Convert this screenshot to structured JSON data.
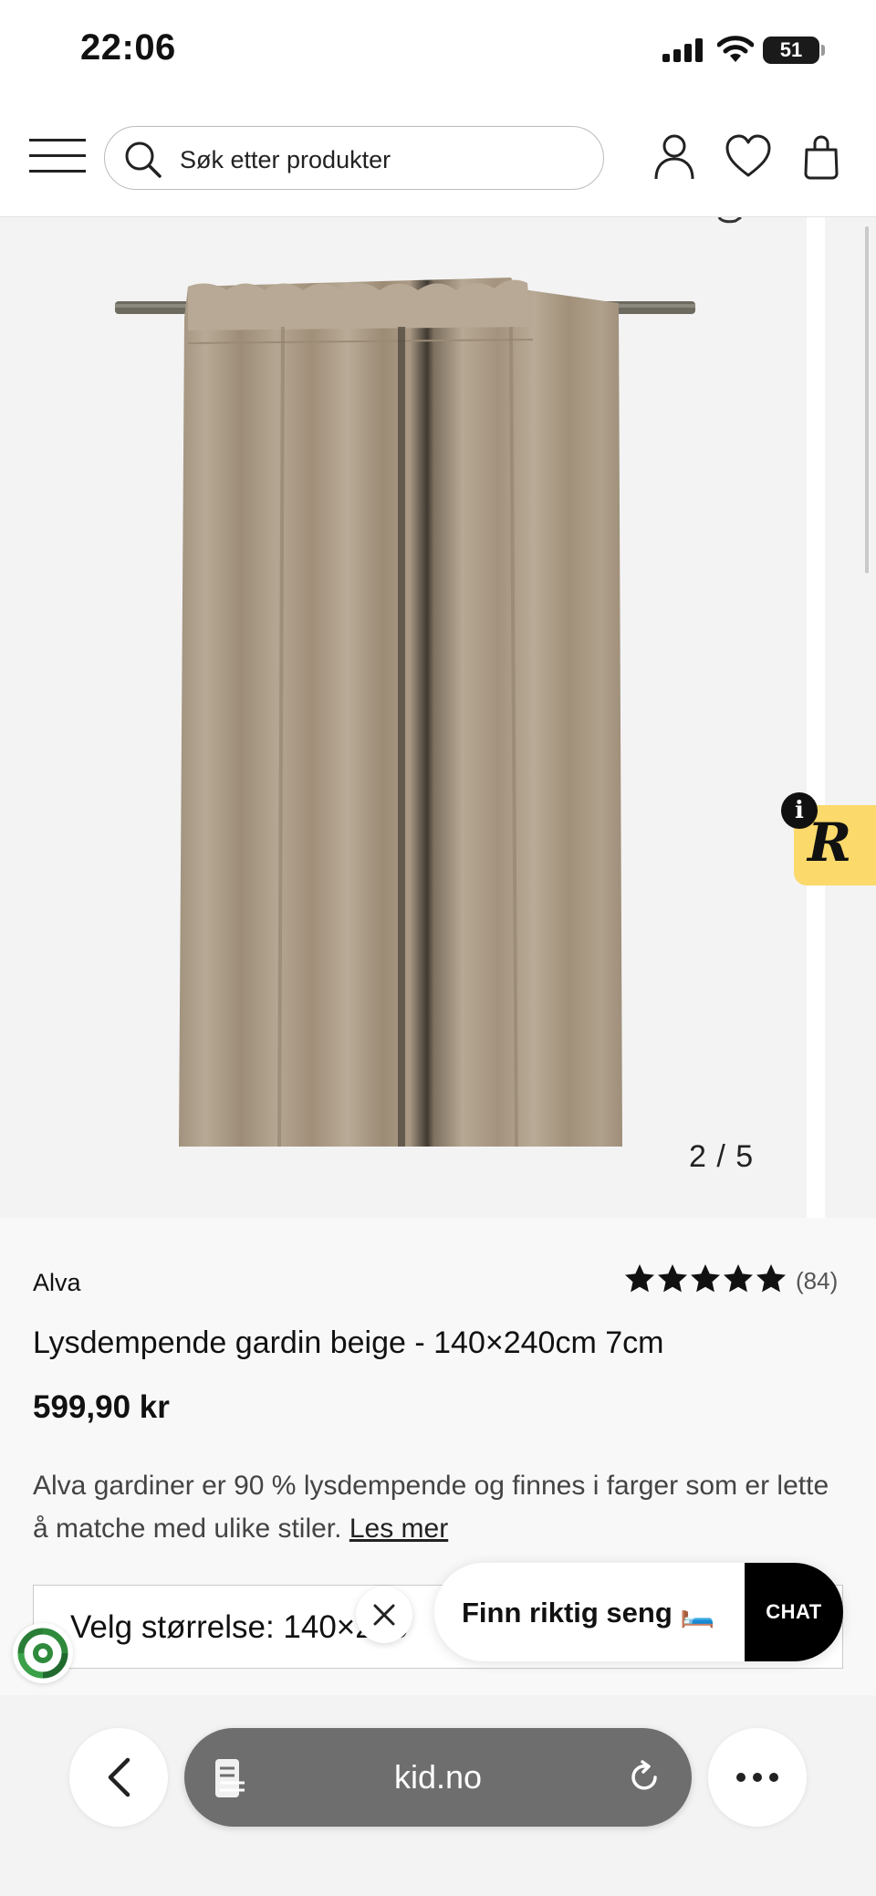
{
  "status_bar": {
    "time": "22:06",
    "battery": "51"
  },
  "header": {
    "search": {
      "placeholder": "Søk etter produkter"
    },
    "icons": [
      "menu-icon",
      "search-icon",
      "user-icon",
      "heart-icon",
      "bag-icon"
    ]
  },
  "gallery": {
    "counter": "2 / 5",
    "current_image": 2,
    "total_images": 5
  },
  "product": {
    "brand": "Alva",
    "rating": 5,
    "review_count": "(84)",
    "title": "Lysdempende gardin beige - 140×240cm 7cm",
    "price": "599,90 kr",
    "description": "Alva gardiner er 90 % lysdempende og finnes i farger som er lette å matche med ulike stiler.",
    "read_more": "Les mer",
    "size_selector": "Velg størrelse: 140×240"
  },
  "chat_widget": {
    "label": "Finn riktig seng 🛏️",
    "button": "CHAT"
  },
  "browser_bar": {
    "url": "kid.no"
  },
  "colors": {
    "badge_yellow": "#fbd96b",
    "curtain": "#a89886",
    "url_bar": "#6e6e6e"
  }
}
